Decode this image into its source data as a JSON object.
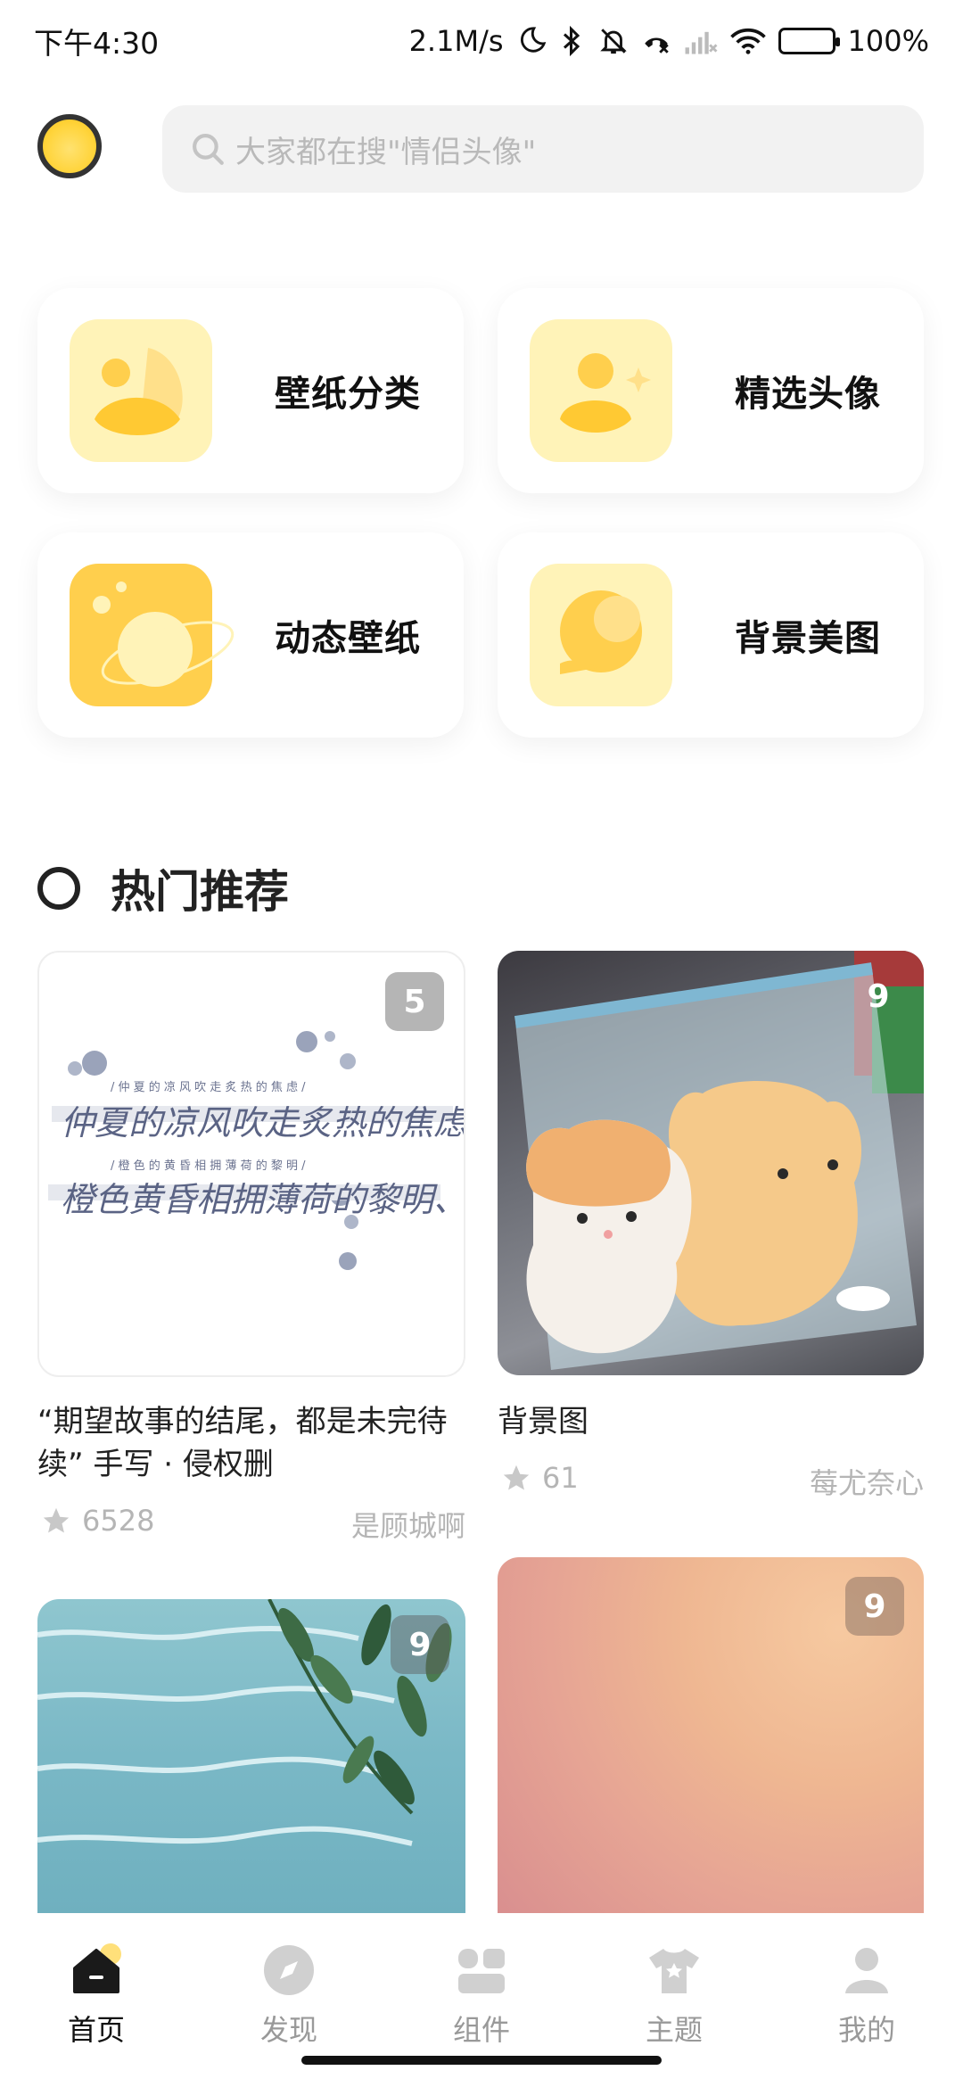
{
  "status_bar": {
    "time": "下午4:30",
    "network_speed": "2.1M/s",
    "battery": "100%"
  },
  "search": {
    "placeholder": "大家都在搜\"情侣头像\""
  },
  "categories": [
    {
      "label": "壁纸分类",
      "icon": "image-icon"
    },
    {
      "label": "精选头像",
      "icon": "avatar-icon"
    },
    {
      "label": "动态壁纸",
      "icon": "planet-icon"
    },
    {
      "label": "背景美图",
      "icon": "bubble-icon"
    }
  ],
  "section": {
    "title": "热门推荐"
  },
  "feed": [
    {
      "badge": "5",
      "title": "“期望故事的结尾，都是未完待续” 手写 · 侵权删",
      "likes": "6528",
      "author": "是顾城啊",
      "image": "handwritten-text",
      "caption_line1": "仲夏的凉风吹走炙热的焦虑、",
      "caption_line2": "橙色黄昏相拥薄荷的黎明、",
      "caption_small1": "/ 仲 夏 的 凉 风 吹 走 炙 热 的 焦 虑 /",
      "caption_small2": "/ 橙 色 的 黄 昏 相 拥 薄 荷 的 黎 明 /"
    },
    {
      "badge": "9",
      "title": "背景图",
      "likes": "61",
      "author": "莓尤奈心",
      "image": "plush-cats-photo"
    },
    {
      "badge": "9",
      "image": "water-leaves-illustration"
    },
    {
      "badge": "9",
      "image": "pink-orange-watercolor"
    }
  ],
  "bottom_nav": [
    {
      "label": "首页",
      "icon": "home-icon",
      "active": true
    },
    {
      "label": "发现",
      "icon": "discover-icon",
      "active": false
    },
    {
      "label": "组件",
      "icon": "widget-icon",
      "active": false
    },
    {
      "label": "主题",
      "icon": "shirt-icon",
      "active": false
    },
    {
      "label": "我的",
      "icon": "user-icon",
      "active": false
    }
  ],
  "colors": {
    "accent_yellow": "#ffd43b",
    "soft_yellow": "#fff3b8",
    "muted_text": "#b5b5b5"
  }
}
